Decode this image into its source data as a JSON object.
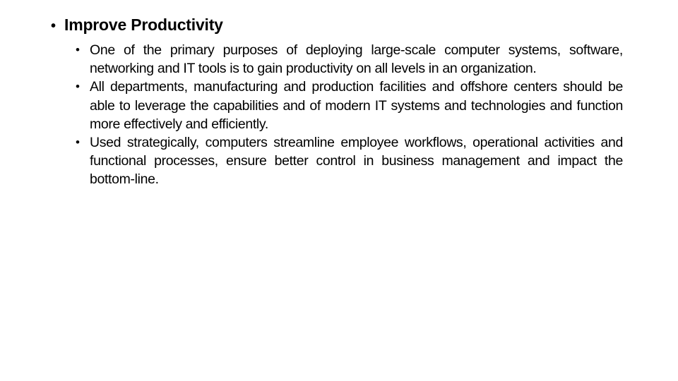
{
  "slide": {
    "heading": {
      "bullet": "•",
      "text": "Improve Productivity"
    },
    "points": [
      {
        "bullet": "•",
        "text": "One of the primary purposes of deploying large-scale computer systems, software, networking and IT tools is to gain productivity on all levels in an organization."
      },
      {
        "bullet": "•",
        "text": "All departments, manufacturing and production facilities and offshore centers should be able to leverage the capabilities and of modern IT systems and technologies and function more effectively and efficiently."
      },
      {
        "bullet": "•",
        "text": "Used strategically, computers streamline employee workflows, operational activities and functional processes, ensure better control in business management and impact the bottom-line."
      }
    ]
  }
}
